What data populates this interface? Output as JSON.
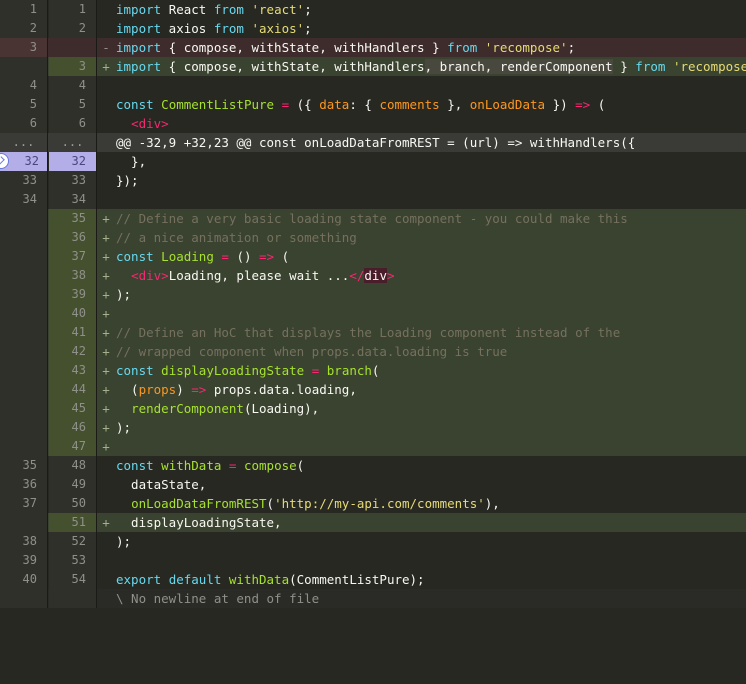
{
  "file_tail": {
    "no_newline": "\\ No newline at end of file"
  },
  "rows": [
    {
      "type": "ctx",
      "old": "1",
      "new": "1",
      "sign": "",
      "tokens": [
        [
          "kw",
          "import"
        ],
        [
          "plain",
          " "
        ],
        [
          "plain",
          "React"
        ],
        [
          "plain",
          " "
        ],
        [
          "kw",
          "from"
        ],
        [
          "plain",
          " "
        ],
        [
          "str",
          "'react'"
        ],
        [
          "plain",
          ";"
        ]
      ]
    },
    {
      "type": "ctx",
      "old": "2",
      "new": "2",
      "sign": "",
      "tokens": [
        [
          "kw",
          "import"
        ],
        [
          "plain",
          " axios "
        ],
        [
          "kw",
          "from"
        ],
        [
          "plain",
          " "
        ],
        [
          "str",
          "'axios'"
        ],
        [
          "plain",
          ";"
        ]
      ]
    },
    {
      "type": "del",
      "old": "3",
      "new": "",
      "sign": "-",
      "tokens": [
        [
          "kw",
          "import"
        ],
        [
          "plain",
          " { compose, withState, withHandlers } "
        ],
        [
          "kw",
          "from"
        ],
        [
          "plain",
          " "
        ],
        [
          "str",
          "'recompose'"
        ],
        [
          "plain",
          ";"
        ]
      ]
    },
    {
      "type": "add",
      "old": "",
      "new": "3",
      "sign": "+",
      "tokens": [
        [
          "kw",
          "import"
        ],
        [
          "plain",
          " { compose, withState, withHandlers"
        ],
        [
          "hl",
          ", branch, renderComponent"
        ],
        [
          "plain",
          " } "
        ],
        [
          "kw",
          "from"
        ],
        [
          "plain",
          " "
        ],
        [
          "str",
          "'recompose'"
        ],
        [
          "plain",
          ";"
        ]
      ]
    },
    {
      "type": "ctx",
      "old": "4",
      "new": "4",
      "sign": "",
      "tokens": []
    },
    {
      "type": "ctx",
      "old": "5",
      "new": "5",
      "sign": "",
      "tokens": [
        [
          "kw",
          "const"
        ],
        [
          "plain",
          " "
        ],
        [
          "fn",
          "CommentListPure"
        ],
        [
          "plain",
          " "
        ],
        [
          "kw2",
          "="
        ],
        [
          "plain",
          " ({ "
        ],
        [
          "arg",
          "data"
        ],
        [
          "plain",
          ": { "
        ],
        [
          "arg",
          "comments"
        ],
        [
          "plain",
          " }, "
        ],
        [
          "arg",
          "onLoadData"
        ],
        [
          "plain",
          " }) "
        ],
        [
          "kw2",
          "=>"
        ],
        [
          "plain",
          " ("
        ]
      ]
    },
    {
      "type": "ctx",
      "old": "6",
      "new": "6",
      "sign": "",
      "tokens": [
        [
          "plain",
          "  "
        ],
        [
          "tag",
          "<div>"
        ]
      ]
    },
    {
      "type": "hunk",
      "old": "...",
      "new": "...",
      "sign": "",
      "tokens": [
        [
          "plain",
          "@@ -32,9 +32,23 @@ const onLoadDataFromREST = (url) => withHandlers({"
        ]
      ]
    },
    {
      "type": "exp",
      "old": "32",
      "new": "32",
      "sign": "",
      "tokens": [
        [
          "plain",
          "  },"
        ]
      ]
    },
    {
      "type": "ctx",
      "old": "33",
      "new": "33",
      "sign": "",
      "tokens": [
        [
          "plain",
          "});"
        ]
      ]
    },
    {
      "type": "ctx",
      "old": "34",
      "new": "34",
      "sign": "",
      "tokens": []
    },
    {
      "type": "add",
      "old": "",
      "new": "35",
      "sign": "+",
      "tokens": [
        [
          "cm",
          "// Define a very basic loading state component - you could make this"
        ]
      ]
    },
    {
      "type": "add",
      "old": "",
      "new": "36",
      "sign": "+",
      "tokens": [
        [
          "cm",
          "// a nice animation or something"
        ]
      ]
    },
    {
      "type": "add",
      "old": "",
      "new": "37",
      "sign": "+",
      "tokens": [
        [
          "kw",
          "const"
        ],
        [
          "plain",
          " "
        ],
        [
          "fn",
          "Loading"
        ],
        [
          "plain",
          " "
        ],
        [
          "kw2",
          "="
        ],
        [
          "plain",
          " () "
        ],
        [
          "kw2",
          "=>"
        ],
        [
          "plain",
          " ("
        ]
      ]
    },
    {
      "type": "add",
      "old": "",
      "new": "38",
      "sign": "+",
      "tokens": [
        [
          "plain",
          "  "
        ],
        [
          "tag",
          "<div>"
        ],
        [
          "plain",
          "Loading, please wait ..."
        ],
        [
          "tag",
          "</"
        ],
        [
          "hlred",
          "div"
        ],
        [
          "tag",
          ">"
        ]
      ]
    },
    {
      "type": "add",
      "old": "",
      "new": "39",
      "sign": "+",
      "tokens": [
        [
          "plain",
          ");"
        ]
      ]
    },
    {
      "type": "add",
      "old": "",
      "new": "40",
      "sign": "+",
      "tokens": []
    },
    {
      "type": "add",
      "old": "",
      "new": "41",
      "sign": "+",
      "tokens": [
        [
          "cm",
          "// Define an HoC that displays the Loading component instead of the"
        ]
      ]
    },
    {
      "type": "add",
      "old": "",
      "new": "42",
      "sign": "+",
      "tokens": [
        [
          "cm",
          "// wrapped component when props.data.loading is true"
        ]
      ]
    },
    {
      "type": "add",
      "old": "",
      "new": "43",
      "sign": "+",
      "tokens": [
        [
          "kw",
          "const"
        ],
        [
          "plain",
          " "
        ],
        [
          "fn",
          "displayLoadingState"
        ],
        [
          "plain",
          " "
        ],
        [
          "kw2",
          "="
        ],
        [
          "plain",
          " "
        ],
        [
          "fn",
          "branch"
        ],
        [
          "plain",
          "("
        ]
      ]
    },
    {
      "type": "add",
      "old": "",
      "new": "44",
      "sign": "+",
      "tokens": [
        [
          "plain",
          "  ("
        ],
        [
          "arg",
          "props"
        ],
        [
          "plain",
          ") "
        ],
        [
          "kw2",
          "=>"
        ],
        [
          "plain",
          " props.data.loading,"
        ]
      ]
    },
    {
      "type": "add",
      "old": "",
      "new": "45",
      "sign": "+",
      "tokens": [
        [
          "plain",
          "  "
        ],
        [
          "fn",
          "renderComponent"
        ],
        [
          "plain",
          "(Loading),"
        ]
      ]
    },
    {
      "type": "add",
      "old": "",
      "new": "46",
      "sign": "+",
      "tokens": [
        [
          "plain",
          ");"
        ]
      ]
    },
    {
      "type": "add",
      "old": "",
      "new": "47",
      "sign": "+",
      "tokens": []
    },
    {
      "type": "ctx",
      "old": "35",
      "new": "48",
      "sign": "",
      "tokens": [
        [
          "kw",
          "const"
        ],
        [
          "plain",
          " "
        ],
        [
          "fn",
          "withData"
        ],
        [
          "plain",
          " "
        ],
        [
          "kw2",
          "="
        ],
        [
          "plain",
          " "
        ],
        [
          "fn",
          "compose"
        ],
        [
          "plain",
          "("
        ]
      ]
    },
    {
      "type": "ctx",
      "old": "36",
      "new": "49",
      "sign": "",
      "tokens": [
        [
          "plain",
          "  dataState,"
        ]
      ]
    },
    {
      "type": "ctx",
      "old": "37",
      "new": "50",
      "sign": "",
      "tokens": [
        [
          "plain",
          "  "
        ],
        [
          "fn",
          "onLoadDataFromREST"
        ],
        [
          "plain",
          "("
        ],
        [
          "str",
          "'http://my-api.com/comments'"
        ],
        [
          "plain",
          "),"
        ]
      ]
    },
    {
      "type": "add",
      "old": "",
      "new": "51",
      "sign": "+",
      "tokens": [
        [
          "plain",
          "  displayLoadingState,"
        ]
      ]
    },
    {
      "type": "ctx",
      "old": "38",
      "new": "52",
      "sign": "",
      "tokens": [
        [
          "plain",
          ");"
        ]
      ]
    },
    {
      "type": "ctx",
      "old": "39",
      "new": "53",
      "sign": "",
      "tokens": []
    },
    {
      "type": "ctx",
      "old": "40",
      "new": "54",
      "sign": "",
      "tokens": [
        [
          "kw",
          "export"
        ],
        [
          "plain",
          " "
        ],
        [
          "kw",
          "default"
        ],
        [
          "plain",
          " "
        ],
        [
          "fn",
          "withData"
        ],
        [
          "plain",
          "(CommentListPure);"
        ]
      ]
    }
  ],
  "colors": {
    "background": "#272822",
    "deleted": "#3e2b2b",
    "added": "#3a4230",
    "expand_button": "#b4aee8"
  },
  "icons": {
    "expand": "expand-lines-icon"
  }
}
